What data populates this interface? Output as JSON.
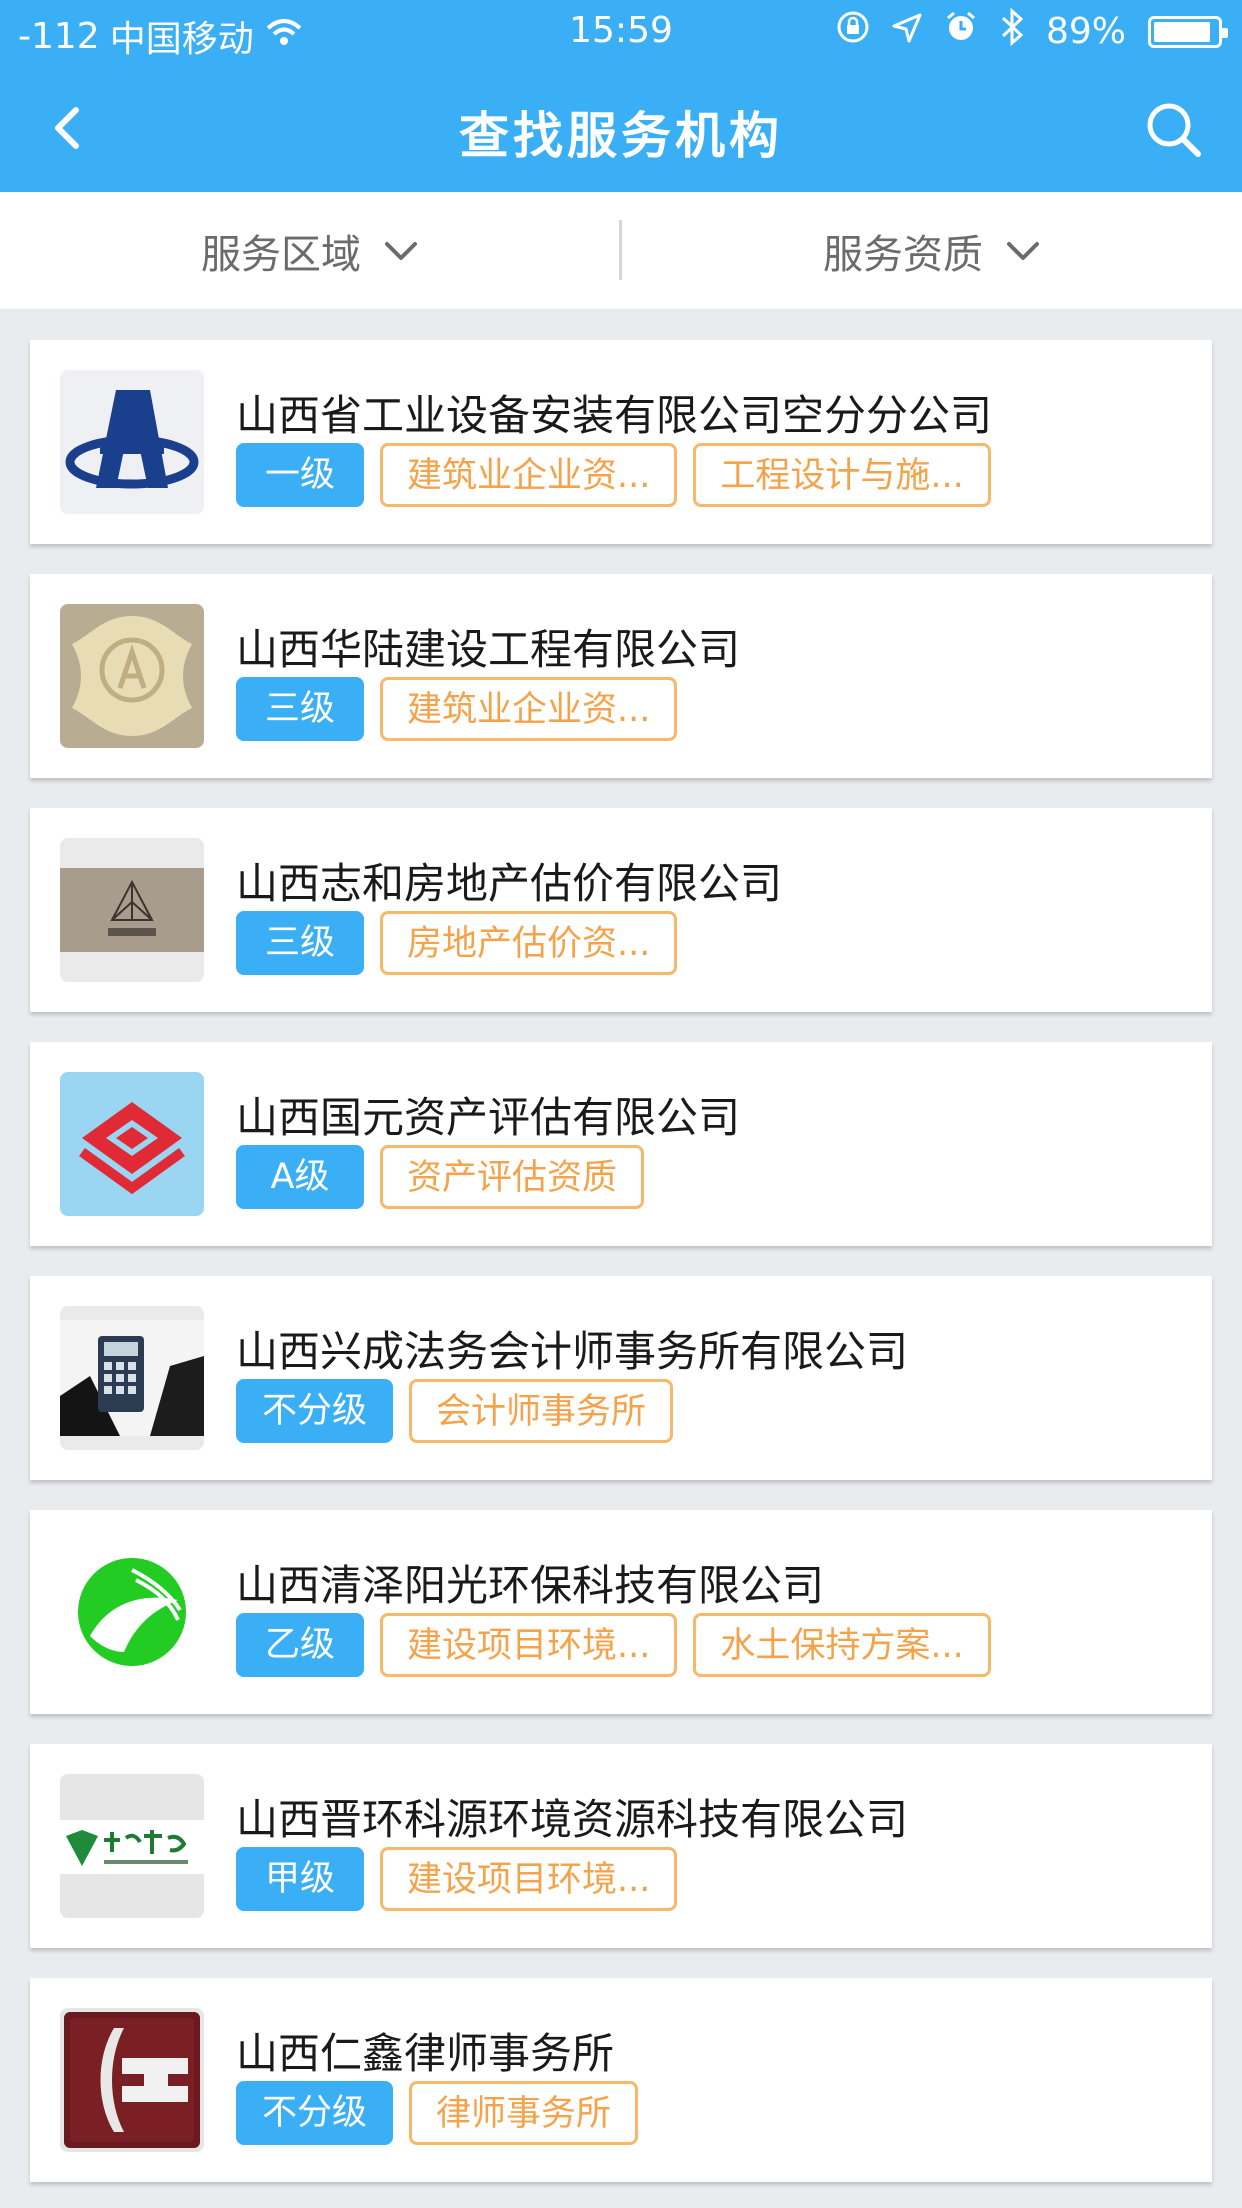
{
  "status_bar": {
    "signal": "-112",
    "carrier": "中国移动",
    "time": "15:59",
    "battery": "89%",
    "battery_level": 0.89
  },
  "header": {
    "title": "查找服务机构",
    "back_icon": "chevron-left-icon",
    "search_icon": "search-icon"
  },
  "filters": [
    {
      "label": "服务区域"
    },
    {
      "label": "服务资质"
    }
  ],
  "colors": {
    "primary": "#3aaff5",
    "tag_orange": "#f5a34a",
    "background": "#e9ecef"
  },
  "organizations": [
    {
      "name": "山西省工业设备安装有限公司空分分公司",
      "level": "一级",
      "qualifications": [
        "建筑业企业资...",
        "工程设计与施..."
      ],
      "logo": "steel-A-logo"
    },
    {
      "name": "山西华陆建设工程有限公司",
      "level": "三级",
      "qualifications": [
        "建筑业企业资..."
      ],
      "logo": "circle-A-emblem"
    },
    {
      "name": "山西志和房地产估价有限公司",
      "level": "三级",
      "qualifications": [
        "房地产估价资..."
      ],
      "logo": "triangle-logo"
    },
    {
      "name": "山西国元资产评估有限公司",
      "level": "A级",
      "qualifications": [
        "资产评估资质"
      ],
      "logo": "red-diamond-logo"
    },
    {
      "name": "山西兴成法务会计师事务所有限公司",
      "level": "不分级",
      "qualifications": [
        "会计师事务所"
      ],
      "logo": "calculator-photo"
    },
    {
      "name": "山西清泽阳光环保科技有限公司",
      "level": "乙级",
      "qualifications": [
        "建设项目环境...",
        "水土保持方案..."
      ],
      "logo": "green-leaf-logo"
    },
    {
      "name": "山西晋环科源环境资源科技有限公司",
      "level": "甲级",
      "qualifications": [
        "建设项目环境..."
      ],
      "logo": "green-calligraphy-logo"
    },
    {
      "name": "山西仁鑫律师事务所",
      "level": "不分级",
      "qualifications": [
        "律师事务所"
      ],
      "logo": "red-metal-logo"
    }
  ]
}
